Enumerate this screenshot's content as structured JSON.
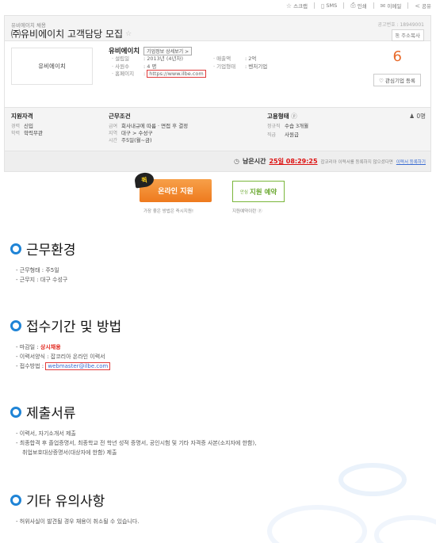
{
  "toolbar": {
    "scrap": "스크랩",
    "sms": "SMS",
    "print": "인쇄",
    "email": "이메일",
    "share": "공유"
  },
  "job": {
    "company_small": "유비에이치 채용",
    "title": "㈜유비에이치 고객담당 모집",
    "pub_no": "공고번호 : 18949001",
    "copy_address": "주소복사"
  },
  "company": {
    "logo_text": "유비에이치",
    "name": "유비에이치",
    "detail_button": "기업정보 상세보기 >",
    "established_label": "· 설립일",
    "established_value": ": 2013년 (4년차)",
    "employees_label": "· 사원수",
    "employees_value": ": 4 명",
    "homepage_label": "· 홈페이지",
    "homepage_value": "https://www.ilbe.com",
    "revenue_label": "· 매출액",
    "revenue_value": ": 2억",
    "type_label": "· 기업형태",
    "type_value": ": 벤처기업",
    "count": "6",
    "interest_button": "관심기업 등록"
  },
  "conditions": {
    "qual": {
      "heading": "지원자격",
      "career_k": "경력",
      "career_v": "신입",
      "edu_k": "학력",
      "edu_v": "학력무관"
    },
    "work": {
      "heading": "근무조건",
      "pay_k": "급여",
      "pay_v": "회사내규에 따름 · 면접 후 결정",
      "area_k": "지역",
      "area_v": "대구 > 수성구",
      "time_k": "시간",
      "time_v": "주5일(월~금)"
    },
    "employ": {
      "heading": "고용형태",
      "count": "0명",
      "type_k": "정규직",
      "type_v": "수습 3개월",
      "rank_k": "직급",
      "rank_v": "사원급"
    }
  },
  "deadline": {
    "remain_label": "남은시간",
    "remain_time": "25일 08:29:25",
    "note": "잡코리아 이력서를 등록하지 않으셨다면",
    "note_link": "이력서 등록하기"
  },
  "apply": {
    "quick_badge": "퀵",
    "online_label": "온라인 지원",
    "reserve_pre": "안심",
    "reserve_label": "지원 예약",
    "online_sub": "가장 좋은 방법은 즉시지원!",
    "reserve_sub": "지원예약이란"
  },
  "sections": {
    "env": {
      "title": "근무환경",
      "items": [
        "근무형태 : 주5일",
        "근무지 : 대구 수성구"
      ]
    },
    "recv": {
      "title": "접수기간 및 방법",
      "deadline_label": "마감일 : ",
      "deadline_value": "상시채용",
      "form": "이력서양식 : 잡코리아 온라인 이력서",
      "method_label": "접수방법 : ",
      "method_value": "webmaster@ilbe.com"
    },
    "docs": {
      "title": "제출서류",
      "item1": "이력서, 자기소개서 제출",
      "item2": "최종합격 후 졸업증명서, 최종학교 전 학년 성적 증명서, 공인시험 및 기타 자격증 사본(소지자에 한함),",
      "item2b": "취업보호대상증명서(대상자에 한함) 제출"
    },
    "etc": {
      "title": "기타 유의사항",
      "item1": "허위사실이 발견될 경우 채용이 취소될 수 있습니다."
    }
  },
  "colors": {
    "accent_blue": "#1f84d6",
    "orange": "#ee7a1e",
    "green": "#7ab63b",
    "red": "#e1251b"
  }
}
